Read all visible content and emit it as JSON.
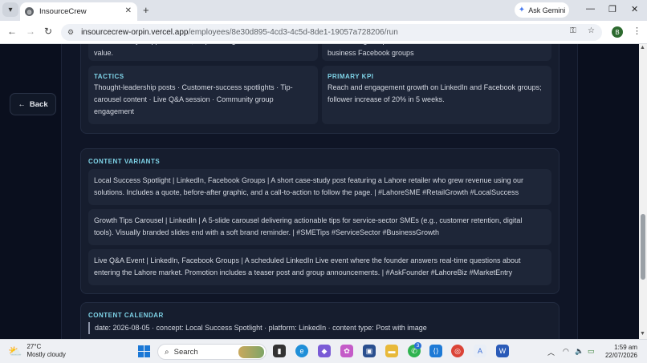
{
  "browser": {
    "tab_title": "InsourceCrew",
    "url_host": "insourcecrew-orpin.vercel.app",
    "url_path": "/employees/8e30d895-4cd3-4c5d-8de1-19057a728206/run",
    "gemini_label": "Ask Gemini",
    "profile_initial": "B"
  },
  "page": {
    "back_label": "Back",
    "tone_text": "Professional yet approachable, emphasizing local relevance and value.",
    "channels_text": "LinkedIn organic posts · LinkedIn articles · LinkedIn Events · Local business Facebook groups",
    "tactics": {
      "label": "TACTICS",
      "text": "Thought-leadership posts · Customer-success spotlights · Tip-carousel content · Live Q&A session · Community group engagement"
    },
    "primary_kpi": {
      "label": "PRIMARY KPI",
      "text": "Reach and engagement growth on LinkedIn and Facebook groups; follower increase of 20% in 5 weeks."
    },
    "content_variants": {
      "label": "CONTENT VARIANTS",
      "items": [
        "Local Success Spotlight | LinkedIn, Facebook Groups | A short case-study post featuring a Lahore retailer who grew revenue using our solutions. Includes a quote, before-after graphic, and a call-to-action to follow the page. | #LahoreSME #RetailGrowth #LocalSuccess",
        "Growth Tips Carousel | LinkedIn | A 5-slide carousel delivering actionable tips for service-sector SMEs (e.g., customer retention, digital tools). Visually branded slides end with a soft brand reminder. | #SMETips #ServiceSector #BusinessGrowth",
        "Live Q&A Event | LinkedIn, Facebook Groups | A scheduled LinkedIn Live event where the founder answers real-time questions about entering the Lahore market. Promotion includes a teaser post and group announcements. | #AskFounder #LahoreBiz #MarketEntry"
      ]
    },
    "content_calendar": {
      "label": "CONTENT CALENDAR",
      "first_entry": "date: 2026-08-05 · concept: Local Success Spotlight · platform: LinkedIn · content type: Post with image"
    }
  },
  "taskbar": {
    "temperature": "27°C",
    "condition": "Mostly cloudy",
    "search_placeholder": "Search",
    "whatsapp_badge": "3",
    "time": "1:59 am",
    "date": "22/07/2026"
  }
}
